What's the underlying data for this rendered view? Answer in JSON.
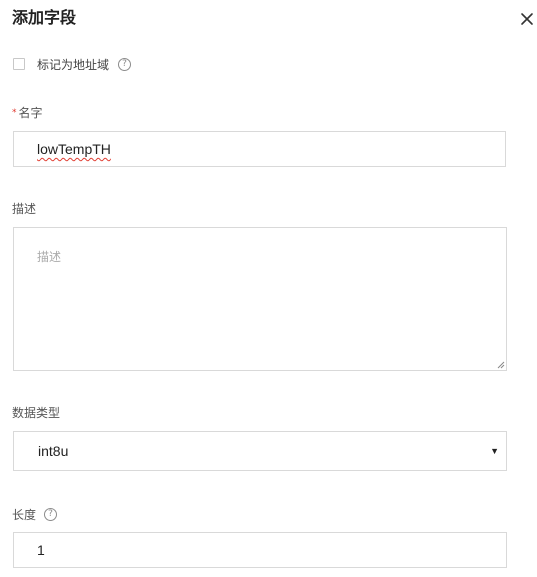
{
  "dialog": {
    "title": "添加字段",
    "close_icon": "close-icon"
  },
  "address_domain": {
    "label": "标记为地址域",
    "checked": false,
    "help_icon": "question-circle-icon",
    "help_glyph": "?"
  },
  "name_field": {
    "required_mark": "*",
    "label": "名字",
    "value": "lowTempTH"
  },
  "description_field": {
    "label": "描述",
    "placeholder": "描述",
    "value": ""
  },
  "data_type_field": {
    "label": "数据类型",
    "selected": "int8u",
    "caret": "▼"
  },
  "length_field": {
    "label": "长度",
    "help_glyph": "?",
    "value": "1"
  }
}
